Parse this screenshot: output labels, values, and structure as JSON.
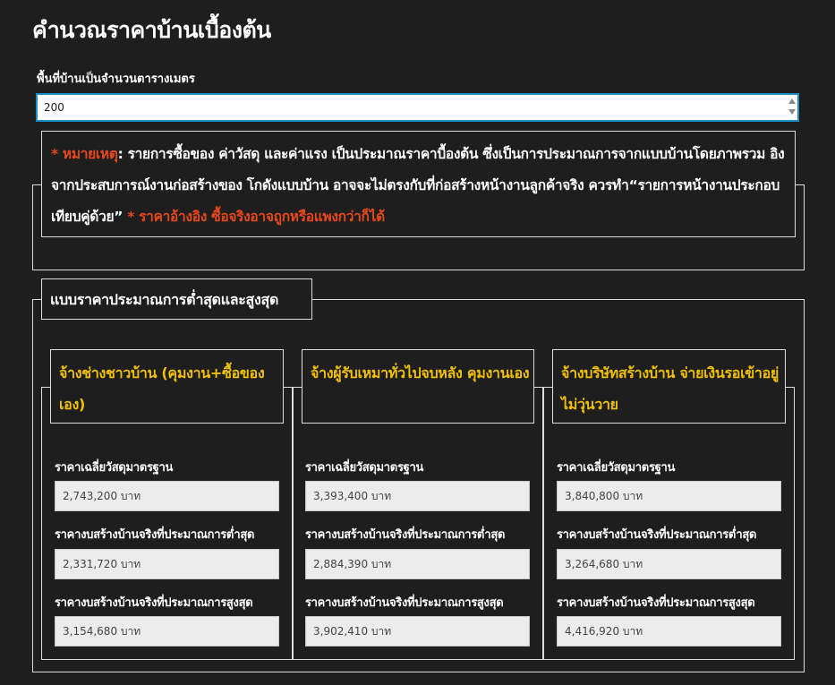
{
  "title": "คำนวณราคาบ้านเบื้องต้น",
  "area": {
    "label": "พื้นที่บ้านเป็นจำนวนตารางเมตร",
    "value": "200"
  },
  "note": {
    "marker": "* หมายเหตุ",
    "text": ": รายการซื้อของ ค่าวัสดุ และค่าแรง เป็นประมาณราคาบื้องต้น ซึ่งเป็นการประมาณการจากแบบบ้านโดยภาพรวม อิงจากประสบการณ์งานก่อสร้างของ โกดังแบบบ้าน อาจจะไม่ตรงกับที่ก่อสร้างหน้างานลูกค้าจริง ควรทำ“รายการหน้างานประกอบเทียบคู่ด้วย” ",
    "warning": "* ราคาอ้างอิง ซื้อจริงอาจถูกหรือแพงกว่าก็ได้"
  },
  "estimate": {
    "heading": "แบบราคาประมาณการต่ำสุดและสูงสุด",
    "columns": [
      {
        "title": "จ้างช่างชาวบ้าน (คุมงาน+ซื้อของเอง)",
        "fields": [
          {
            "label": "ราคาเฉลี่ยวัสดุมาตรฐาน",
            "value": "2,743,200 บาท"
          },
          {
            "label": "ราคางบสร้างบ้านจริงที่ประมาณการต่ำสุด",
            "value": "2,331,720 บาท"
          },
          {
            "label": "ราคางบสร้างบ้านจริงที่ประมาณการสูงสุด",
            "value": "3,154,680 บาท"
          }
        ]
      },
      {
        "title": "จ้างผู้รับเหมาทั่วไปจบหลัง คุมงานเอง",
        "fields": [
          {
            "label": "ราคาเฉลี่ยวัสดุมาตรฐาน",
            "value": "3,393,400 บาท"
          },
          {
            "label": "ราคางบสร้างบ้านจริงที่ประมาณการต่ำสุด",
            "value": "2,884,390 บาท"
          },
          {
            "label": "ราคางบสร้างบ้านจริงที่ประมาณการสูงสุด",
            "value": "3,902,410 บาท"
          }
        ]
      },
      {
        "title": "จ้างบริษัทสร้างบ้าน จ่ายเงินรอเข้าอยู่ ไม่วุ่นวาย",
        "fields": [
          {
            "label": "ราคาเฉลี่ยวัสดุมาตรฐาน",
            "value": "3,840,800 บาท"
          },
          {
            "label": "ราคางบสร้างบ้านจริงที่ประมาณการต่ำสุด",
            "value": "3,264,680 บาท"
          },
          {
            "label": "ราคางบสร้างบ้านจริงที่ประมาณการสูงสุด",
            "value": "4,416,920 บาท"
          }
        ]
      }
    ]
  },
  "colors": {
    "background": "#1e1e1e",
    "accent_red": "#e8481c",
    "accent_yellow": "#f0c000",
    "input_border": "#1a8fc9"
  }
}
